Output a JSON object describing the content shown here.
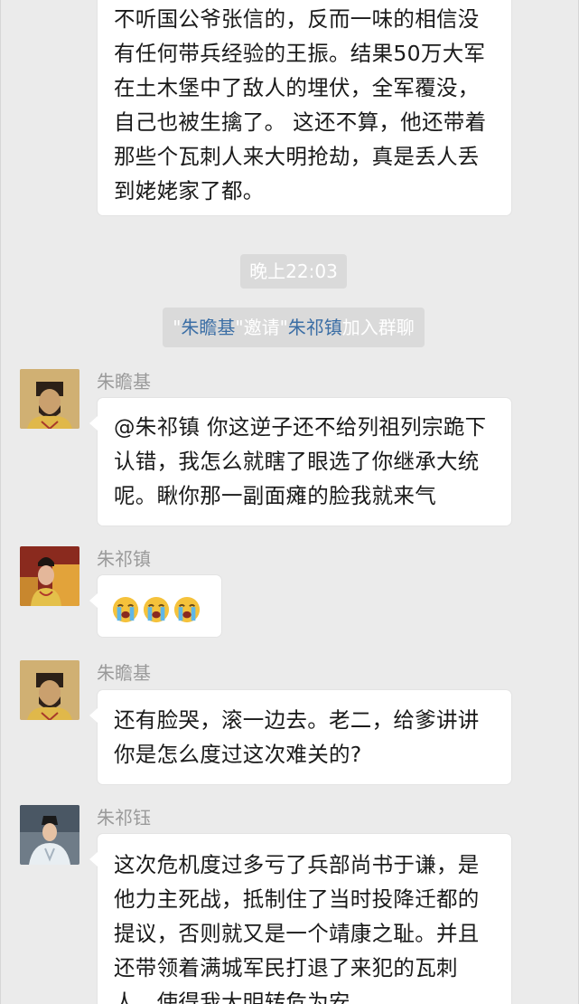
{
  "messages": {
    "m0": {
      "lines": [
        "不听国公爷张信的，反而一味的相信没",
        "有任何带兵经验的王振。结果50万大军",
        "在土木堡中了敌人的埋伏，全军覆没，",
        "自己也被生擒了。 这还不算，他还带着",
        "那些个瓦刺人来大明抢劫，真是丢人丢",
        "到姥姥家了都。"
      ]
    },
    "time": "晚上22:03",
    "system": {
      "q1": "\"",
      "inviter": "朱瞻基",
      "q2": "\"邀请\"",
      "invitee": "朱祁镇",
      "tail": "加入群聊"
    },
    "m1": {
      "sender": "朱瞻基",
      "lines": [
        "@朱祁镇 你这逆子还不给列祖列宗跪下",
        "认错，我怎么就瞎了眼选了你继承大统",
        "呢。瞅你那一副面瘫的脸我就来气"
      ]
    },
    "m2": {
      "sender": "朱祁镇",
      "emojis": [
        "loudly-crying-face",
        "loudly-crying-face",
        "loudly-crying-face"
      ]
    },
    "m3": {
      "sender": "朱瞻基",
      "lines": [
        "还有脸哭，滚一边去。老二，给爹讲讲",
        "你是怎么度过这次难关的?"
      ]
    },
    "m4": {
      "sender": "朱祁钰",
      "lines": [
        "这次危机度过多亏了兵部尚书于谦，是",
        "他力主死战，抵制住了当时投降迁都的",
        "提议，否则就又是一个靖康之耻。并且",
        "还带领着满城军民打退了来犯的瓦刺",
        "人，使得我大明转危为安。"
      ]
    }
  },
  "colors": {
    "background": "#ebebeb",
    "bubble": "#ffffff",
    "sender_name": "#9a9a9a",
    "mention_link": "#3b6ea5",
    "system_pill": "#dadada"
  }
}
